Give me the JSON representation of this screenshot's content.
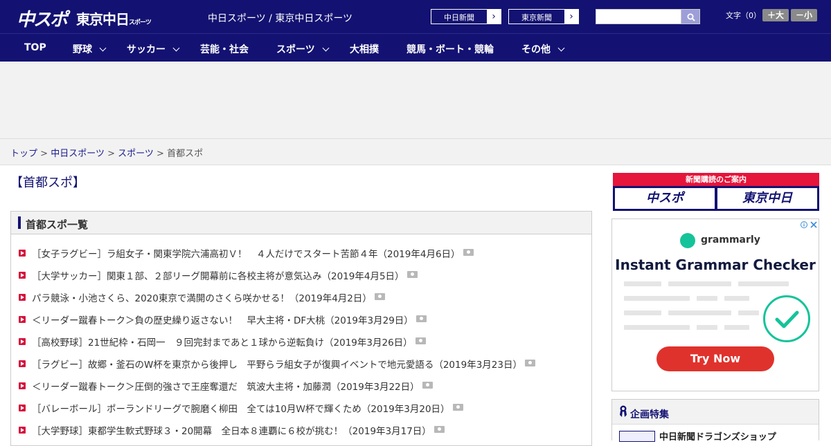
{
  "header": {
    "logo_chunichi_sports": "中スポ",
    "logo_tokyo_chunichi": "東京中日",
    "logo_tokyo_chunichi_sub": "スポーツ",
    "site_title": "中日スポーツ / 東京中日スポーツ",
    "paper_links": [
      {
        "label": "中日新聞"
      },
      {
        "label": "東京新聞"
      }
    ],
    "search": {
      "value": "",
      "placeholder": ""
    },
    "font_size_label": "文字（0）",
    "font_larger": "＋大",
    "font_smaller": "－小"
  },
  "nav": {
    "items": [
      {
        "label": "TOP",
        "dropdown": false
      },
      {
        "label": "野球",
        "dropdown": true
      },
      {
        "label": "サッカー",
        "dropdown": true
      },
      {
        "label": "芸能・社会",
        "dropdown": false
      },
      {
        "label": "スポーツ",
        "dropdown": true
      },
      {
        "label": "大相撲",
        "dropdown": false
      },
      {
        "label": "競馬・ボート・競輪",
        "dropdown": false
      },
      {
        "label": "その他",
        "dropdown": true
      }
    ]
  },
  "breadcrumb": {
    "items": [
      "トップ",
      "中日スポーツ",
      "スポーツ"
    ],
    "current": "首都スポ",
    "separator": ">"
  },
  "page": {
    "title": "【首都スポ】",
    "list_title": "首都スポ一覧",
    "articles": [
      "［女子ラグビー］ラ組女子・関東学院六浦高初Ｖ！　４人だけでスタート苦節４年（2019年4月6日）",
      "［大学サッカー］関東１部、２部リーグ開幕前に各校主将が意気込み（2019年4月5日）",
      "パラ競泳・小池さくら、2020東京で満開のさくら咲かせる！（2019年4月2日）",
      "＜リーダー蹴春トーク＞負の歴史繰り返さない！　早大主将・DF大桃（2019年3月29日）",
      "［高校野球］21世紀枠・石岡一　９回完封まであと１球から逆転負け（2019年3月26日）",
      "［ラグビー］故郷・釜石のW杯を東京から後押し　平野らラ組女子が復興イベントで地元愛語る（2019年3月23日）",
      "＜リーダー蹴春トーク＞圧倒的強さで王座奪還だ　筑波大主将・加藤潤（2019年3月22日）",
      "［バレーボール］ポーランドリーグで腕磨く柳田　全ては10月Ｗ杯で輝くため（2019年3月20日）",
      "［大学野球］東都学生軟式野球３・20開幕　全日本８連覇に６校が挑む！（2019年3月17日）"
    ]
  },
  "sidebar": {
    "subscription_head": "新聞購読のご案内",
    "subscription_links": [
      "中スポ",
      "東京中日"
    ],
    "ad": {
      "brand": "grammarly",
      "headline": "Instant Grammar Checker",
      "cta": "Try Now",
      "accent": "#15c39a",
      "cta_color": "#e0322c"
    },
    "feature_title": "企画特集",
    "feature_item": "中日新聞ドラゴンズショップ"
  },
  "colors": {
    "navy": "#131272",
    "red": "#d6123c",
    "link": "#1a1a8c"
  }
}
